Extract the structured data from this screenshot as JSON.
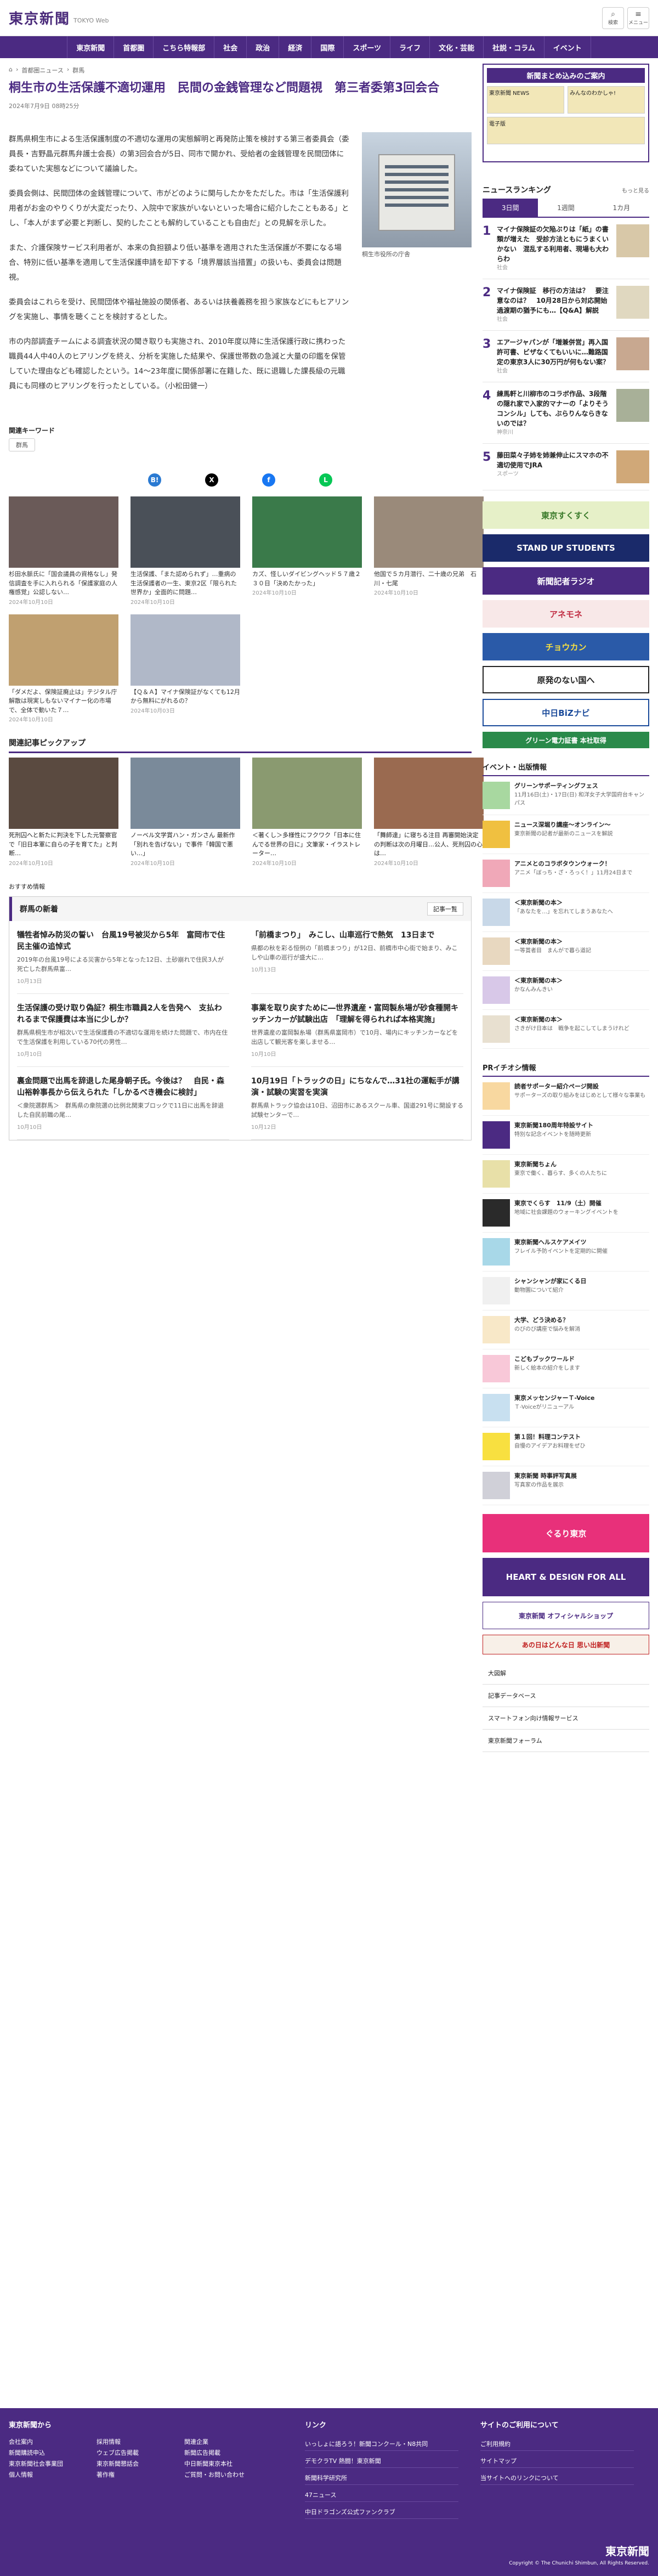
{
  "header": {
    "logo": "東京新聞",
    "logo_sub": "TOKYO Web",
    "search": "検索",
    "menu": "メニュー"
  },
  "nav": [
    "東京新聞",
    "首都圏",
    "こちら特報部",
    "社会",
    "政治",
    "経済",
    "国際",
    "スポーツ",
    "ライフ",
    "文化・芸能",
    "社説・コラム",
    "イベント"
  ],
  "breadcrumb": [
    "首都圏ニュース",
    "群馬"
  ],
  "article": {
    "title": "桐生市の生活保護不適切運用　民間の金銭管理など問題視　第三者委第3回会合",
    "date": "2024年7月9日 08時25分",
    "paragraphs": [
      "群馬県桐生市による生活保護制度の不適切な運用の実態解明と再発防止策を検討する第三者委員会（委員長・吉野晶元群馬弁護士会長）の第3回会合が5日、同市で開かれ、受給者の金銭管理を民間団体に委ねていた実態などについて議論した。",
      "委員会側は、民間団体の金銭管理について、市がどのように関与したかをただした。市は「生活保護利用者がお金のやりくりが大変だったり、入院中で家族がいないといった場合に紹介したこともある」とし、「本人がまず必要と判断し、契約したことも解約していることも自由だ」との見解を示した。",
      "また、介護保険サービス利用者が、本来の負担額より低い基準を適用された生活保護が不要になる場合、特別に低い基準を適用して生活保護申請を却下する「境界層該当措置」の扱いも、委員会は問題視。",
      "委員会はこれらを受け、民間団体や福祉施設の関係者、あるいは扶養義務を担う家族などにもヒアリングを実施し、事情を聴くことを検討するとした。",
      "市の内部調査チームによる調査状況の聞き取りも実施され、2010年度以降に生活保護行政に携わった職員44人中40人のヒアリングを終え、分析を実施した結果や、保護世帯数の急減と大量の印鑑を保管していた理由なども確認したという。14～23年度に関係部署に在籍した、既に退職した課長級の元職員にも同様のヒアリングを行ったとしている。（小松田健一）"
    ],
    "photo_caption": "桐生市役所の庁舎"
  },
  "keywords_label": "関連キーワード",
  "keywords": [
    "群馬"
  ],
  "share": [
    "B!",
    "X",
    "f",
    "L"
  ],
  "related": [
    {
      "t": "杉田水脈氏に「国会議員の資格なし」発信調査を手に入れられる「保護家庭の人権感覚」公認しない…",
      "d": "2024年10月10日"
    },
    {
      "t": "生活保護、「また認められず」…重病の生活保護者の一生、東京2区「限られた世界か」全面的に問題…",
      "d": "2024年10月10日"
    },
    {
      "t": "カズ、怪しいダイビングヘッド５７歳２３０日「決めたかった」",
      "d": "2024年10月10日"
    },
    {
      "t": "他国で５カ月潜行、二十歳の兄弟　石川・七尾",
      "d": "2024年10月10日"
    },
    {
      "t": "「ダメだよ、保険証廃止は」テジタル庁解散は現実しもないマイナー化の市場で、全体で動いた７…",
      "d": "2024年10月10日"
    },
    {
      "t": "【Ｑ＆Ａ】マイナ保険証がなくても12月から無料にがれるの？",
      "d": "2024年10月03日"
    }
  ],
  "pickup_label": "関連記事ピックアップ",
  "pickup": [
    {
      "t": "死刑囚へと新たに判決を下した元警察官で「旧日本軍に自らの子を育てた」と判断…",
      "d": "2024年10月10日"
    },
    {
      "t": "ノーベル文学賞ハン・ガンさん 最新作「別れを告げない」で事件「韓国で悪い…」",
      "d": "2024年10月10日"
    },
    {
      "t": "＜著くし＞多様性にフクワク「日本に住んでる世界の日に」文筆家・イラストレーター…",
      "d": "2024年10月10日"
    },
    {
      "t": "「舞師達」に寝ちる注目 再審開始決定の判断は次の月曜日…公人、死刑囚の心は…",
      "d": "2024年10月10日"
    }
  ],
  "recommend": "おすすめ情報",
  "gunma": {
    "title": "群馬の新着",
    "more": "記事一覧",
    "items": [
      {
        "t": "犠牲者悼み防災の誓い　台風19号被災から5年　富岡市で住民主催の追悼式",
        "s": "2019年の台風19号による災害から5年となった12日、土砂崩れで住民3人が死亡した群馬県富…",
        "d": "10月13日"
      },
      {
        "t": "「前橋まつり」　みこし、山車巡行で熱気　13日まで",
        "s": "県都の秋を彩る恒例の「前橋まつり」が12日、前橋市中心街で始まり、みこしや山車の巡行が盛大に…",
        "d": "10月13日"
      },
      {
        "t": "生活保護の受け取り偽証？桐生市職員2人を告発へ　支払われるまで保護費は本当に少しか？",
        "s": "群馬県桐生市が相次いで生活保護費の不適切な運用を続けた問題で、市内在住で生活保護を利用している70代の男性…",
        "d": "10月10日"
      },
      {
        "t": "事業を取り戻すために―世界遺産・富岡製糸場が砂食種開キッチンカーが試験出店　「理解を得られれば本格実施」",
        "s": "世界遺産の富岡製糸場（群馬県富岡市）で10月、場内にキッチンカーなどを出店して観光客を楽しませる…",
        "d": "10月10日"
      },
      {
        "t": "裏金問題で出馬を辞退した尾身朝子氏。今後は？　自民・森山裕幹事長から伝えられた「しかるべき機会に検討」",
        "s": "＜衆院選群馬＞　群馬県の衆院選の比例北関東ブロックで11日に出馬を辞退した自民前職の尾…",
        "d": "10月10日"
      },
      {
        "t": "10月19日「トラックの日」にちなんで…31社の運転手が講演・試験の実習を実演",
        "s": "群馬県トラック協会は10日、沼田市にあるスクール車、国道291号に開設する試験センターで…",
        "d": "10月12日"
      }
    ]
  },
  "side": {
    "ad_band": "新聞まとめ込みのご案内",
    "ad_cells": [
      "東京新聞 NEWS",
      "みんなのわかしゃ!",
      "電子版"
    ],
    "ranking_title": "ニュースランキング",
    "ranking_more": "もっと見る",
    "ranking_tabs": [
      "3日間",
      "1週間",
      "1カ月"
    ],
    "ranking": [
      {
        "t": "マイナ保険証の欠陥ぶりは「紙」の書類が増えた　受診方法ともにうまくいかない　混乱する利用者、現場も大わらわ",
        "c": "社会"
      },
      {
        "t": "マイナ保険証　移行の方法は？　要注意なのは？　10月28日から対応開始　過渡期の猶予にも…【Q&A】解説",
        "c": "社会"
      },
      {
        "t": "エアージャパンが「増兼併営」再入国許可書、ビザなくてもいいに…難路国定の東京3人に30万円が何もない案？",
        "c": "社会"
      },
      {
        "t": "練馬軒と川柳市のコラボ作品、3段階の隠れ家で入家的マナーの「よりそうコンシル」しても、ぶらりんならきないのでは？",
        "c": "神奈川"
      },
      {
        "t": "藤田菜々子姉を姉兼伸止にスマホの不適切使用でJRA",
        "c": "スポーツ"
      }
    ],
    "banners": [
      "東京すくすく",
      "STAND UP STUDENTS",
      "新聞記者ラジオ",
      "アネモネ",
      "チョウカン",
      "原発のない国へ",
      "中日BiZナビ",
      "グリーン電力証書 本社取得"
    ],
    "events_title": "イベント・出版情報",
    "events": [
      {
        "t": "グリーンサポーティングフェス",
        "s": "11月16日(土)・17日(日) 和洋女子大学国府台キャンパス"
      },
      {
        "t": "ニュース深堀り講座～オンライン～",
        "s": "東京新聞の記者が最新のニュースを解説"
      },
      {
        "t": "アニメとのコラボタウンウォーク！",
        "s": "アニメ「ぼっち・ざ・ろっく！」11月24日まで"
      },
      {
        "t": "＜東京新聞の本＞",
        "s": "「あなたを…」を忘れてしまうあなたへ"
      },
      {
        "t": "＜東京新聞の本＞",
        "s": "一等賞者目　まんがで暮ら道記"
      },
      {
        "t": "＜東京新聞の本＞",
        "s": "かなんみんきい"
      },
      {
        "t": "＜東京新聞の本＞",
        "s": "さきがけ日本は　戦争を起こしてしまうけれど"
      }
    ],
    "pr_title": "PRイチオシ情報",
    "pr": [
      {
        "t": "読者サポーター紹介ページ開設",
        "s": "サポーターズの取り組みをはじめとして様々な事業も"
      },
      {
        "t": "東京新聞180周年特設サイト",
        "s": "特別な記念イベントを随時更新"
      },
      {
        "t": "東京新聞ちょん",
        "s": "東京で働く、暮らす、多くの人たちに"
      },
      {
        "t": "東京でくらす　11/9（土）開催",
        "s": "地域に社会課題のウォーキングイベントを"
      },
      {
        "t": "東京新聞ヘルスケアメイツ",
        "s": "フレイル予防イベントを定期的に開催"
      },
      {
        "t": "シャンシャンが家にくる日",
        "s": "動物園について紹介"
      },
      {
        "t": "大学、どう決める？",
        "s": "のびのび講座で悩みを解消"
      },
      {
        "t": "こどもブックワールド",
        "s": "新しく絵本の紹介をします"
      },
      {
        "t": "東京メッセンジャーＴ-Voice",
        "s": "Ｔ-Voiceがリニューアル"
      },
      {
        "t": "第１回！料理コンテスト",
        "s": "自慢のアイデアお料理をぜひ"
      },
      {
        "t": "東京新聞 時事評写真展",
        "s": "写真家の作品を展示"
      }
    ],
    "banners2": [
      "ぐるり東京",
      "HEART & DESIGN FOR ALL",
      "東京新聞 オフィシャルショップ",
      "あの日はどんな日 思い出新聞"
    ],
    "links": [
      "大図解",
      "記事データベース",
      "スマートフォン向け情報サービス",
      "東京新聞フォーラム"
    ]
  },
  "footer": {
    "col1_title": "東京新聞から",
    "col1": [
      "会社案内",
      "採用情報",
      "関連企業",
      "新聞購読申込",
      "ウェブ広告掲載",
      "新聞広告掲載",
      "東京新聞社会事業団",
      "東京新聞懇話会",
      "中日新聞東京本社",
      "個人情報",
      "著作権",
      "ご質問・お問い合わせ"
    ],
    "col2_title": "リンク",
    "col2": [
      "いっしょに語ろう！新聞コンクール・N8共同",
      "デモクラTV 熱闘！東京新聞",
      "新聞科学研究所",
      "47ニュース",
      "中日ドラゴンズ公式ファンクラブ"
    ],
    "col3_title": "サイトのご利用について",
    "col3": [
      "ご利用規約",
      "サイトマップ",
      "当サイトへのリンクについて"
    ],
    "logo": "東京新聞",
    "copyright": "Copyright © The Chunichi Shimbun, All Rights Reserved."
  }
}
